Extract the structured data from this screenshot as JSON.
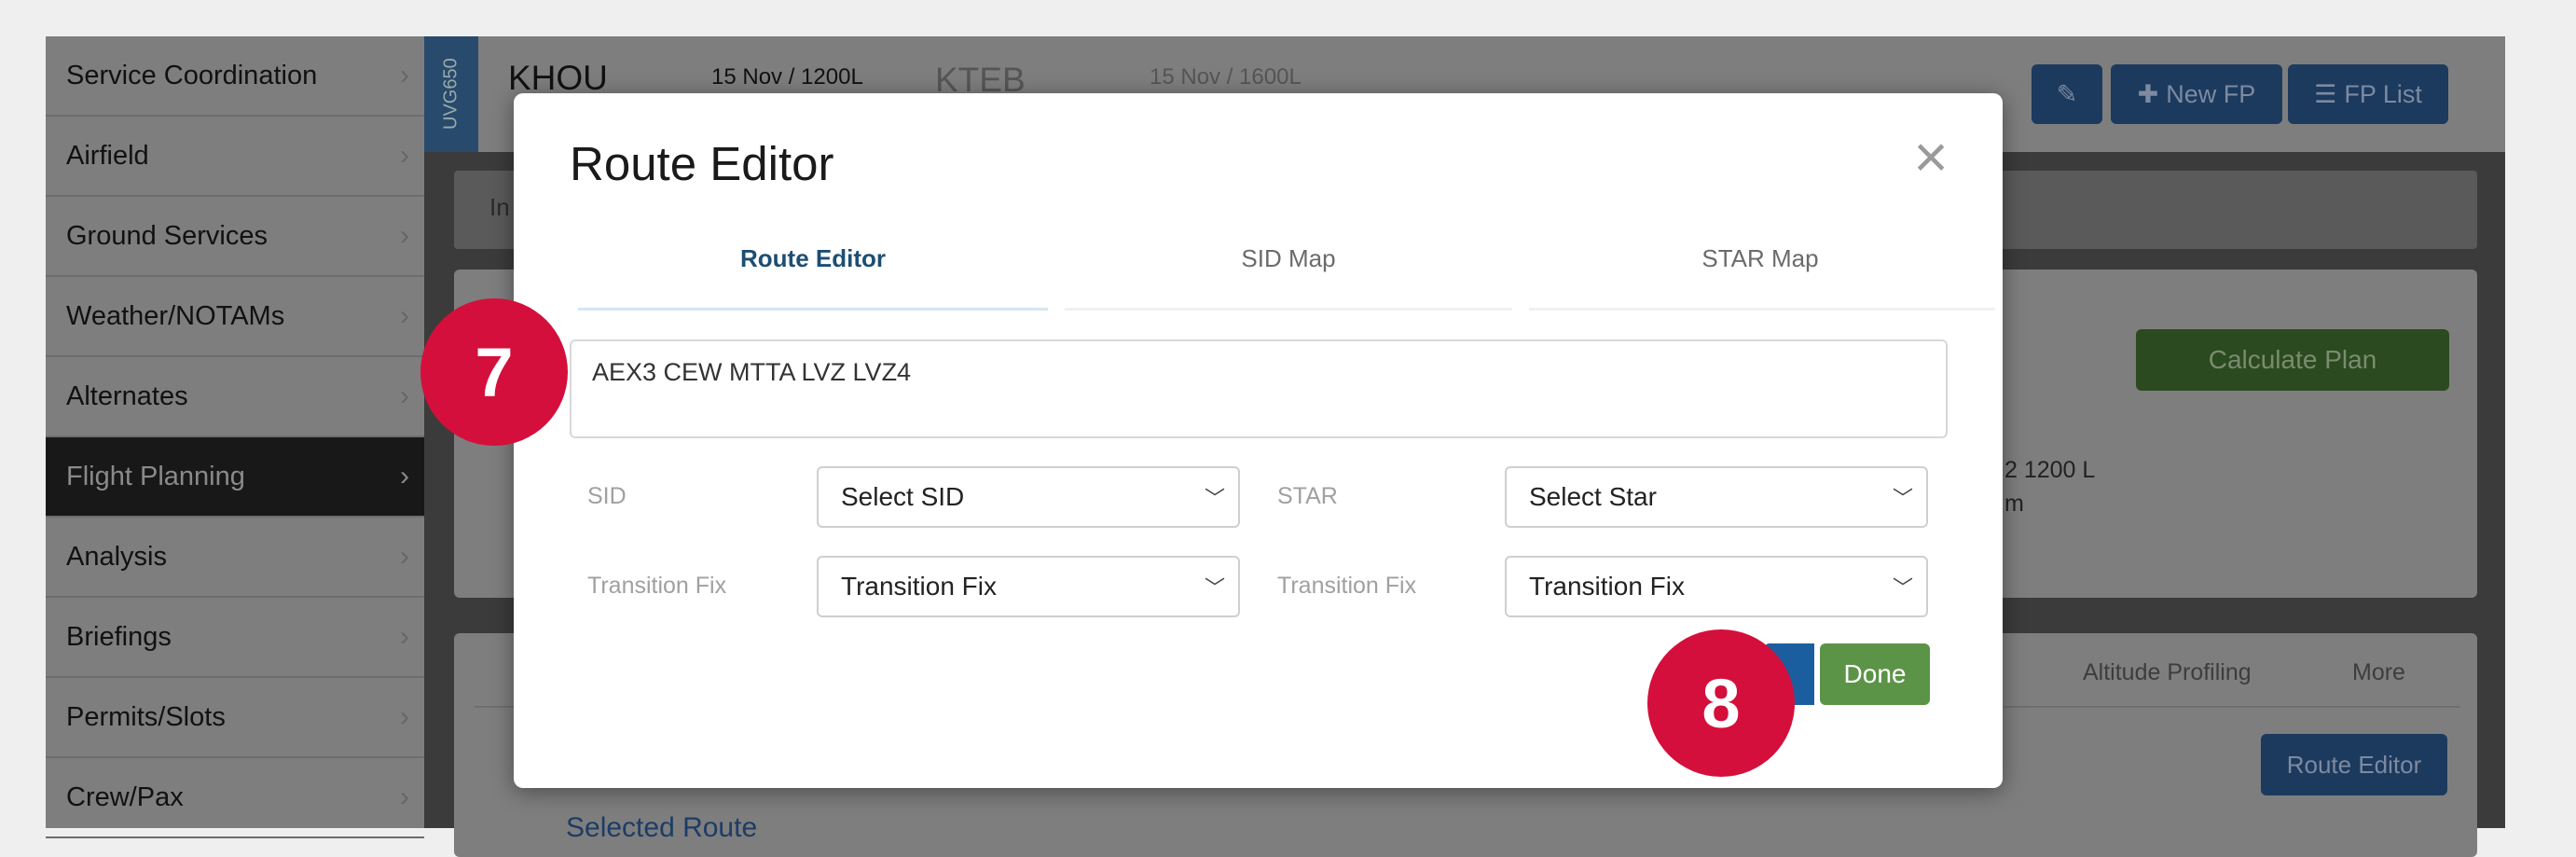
{
  "sidebar": {
    "items": [
      {
        "label": "Service Coordination",
        "active": false
      },
      {
        "label": "Airfield",
        "active": false
      },
      {
        "label": "Ground Services",
        "active": false
      },
      {
        "label": "Weather/NOTAMs",
        "active": false
      },
      {
        "label": "Alternates",
        "active": false
      },
      {
        "label": "Flight Planning",
        "active": true
      },
      {
        "label": "Analysis",
        "active": false
      },
      {
        "label": "Briefings",
        "active": false
      },
      {
        "label": "Permits/Slots",
        "active": false
      },
      {
        "label": "Crew/Pax",
        "active": false
      }
    ]
  },
  "header": {
    "registration": "UVG650",
    "origin_code": "KHOU",
    "origin_time": "15 Nov / 1200L",
    "destination_code": "KTEB",
    "destination_time": "15 Nov / 1600L",
    "new_fp_label": "New FP",
    "fp_list_label": "FP List"
  },
  "background": {
    "infobar_text": "In",
    "calculate_plan_label": "Calculate Plan",
    "date_fragment": "2 1200 L",
    "unit_fragment": "m",
    "tabs": [
      "Altitude Profiling",
      "More"
    ],
    "route_editor_label": "Route Editor",
    "selected_route_label": "Selected Route"
  },
  "modal": {
    "title": "Route Editor",
    "close_symbol": "×",
    "tabs": [
      {
        "label": "Route Editor",
        "active": true
      },
      {
        "label": "SID Map",
        "active": false
      },
      {
        "label": "STAR Map",
        "active": false
      }
    ],
    "route_text": "AEX3 CEW MTTA  LVZ LVZ4",
    "sid_label": "SID",
    "sid_value": "Select SID",
    "star_label": "STAR",
    "star_value": "Select Star",
    "transition_label_left": "Transition Fix",
    "transition_value_left": "Transition Fix",
    "transition_label_right": "Transition Fix",
    "transition_value_right": "Transition Fix",
    "done_label": "Done"
  },
  "badges": {
    "step_7": "7",
    "step_8": "8"
  },
  "colors": {
    "accent_blue": "#1d4e74",
    "done_green": "#5c9447",
    "badge_red": "#d40f3c"
  }
}
